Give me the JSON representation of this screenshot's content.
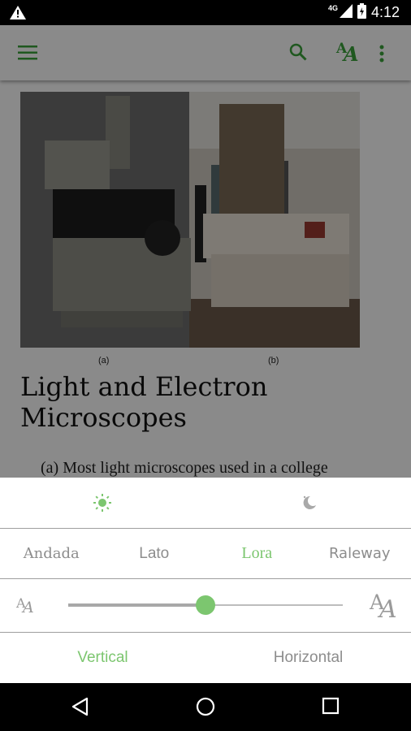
{
  "status_bar": {
    "network": "4G",
    "time": "4:12",
    "icons": [
      "warning-icon",
      "signal-icon",
      "battery-icon"
    ]
  },
  "app_bar": {
    "font_button_glyph": "A",
    "icons": [
      "menu-icon",
      "search-icon",
      "font-size-icon",
      "more-vert-icon"
    ]
  },
  "article": {
    "caption_a": "(a)",
    "caption_b": "(b)",
    "title": "Light and Electron Microscopes",
    "body_start": "(a) Most light microscopes used in a college"
  },
  "settings": {
    "themes": [
      "sun-icon",
      "moon-icon"
    ],
    "fonts": [
      "Andada",
      "Lato",
      "Lora",
      "Raleway"
    ],
    "selected_font": "Lora",
    "text_size_level": 0.5,
    "orientations": [
      "Vertical",
      "Horizontal"
    ],
    "selected_orientation": "Vertical"
  },
  "colors": {
    "accent": "#7cc66f",
    "icon_green": "#3aa33a",
    "inactive_text": "#8d8d8d"
  }
}
